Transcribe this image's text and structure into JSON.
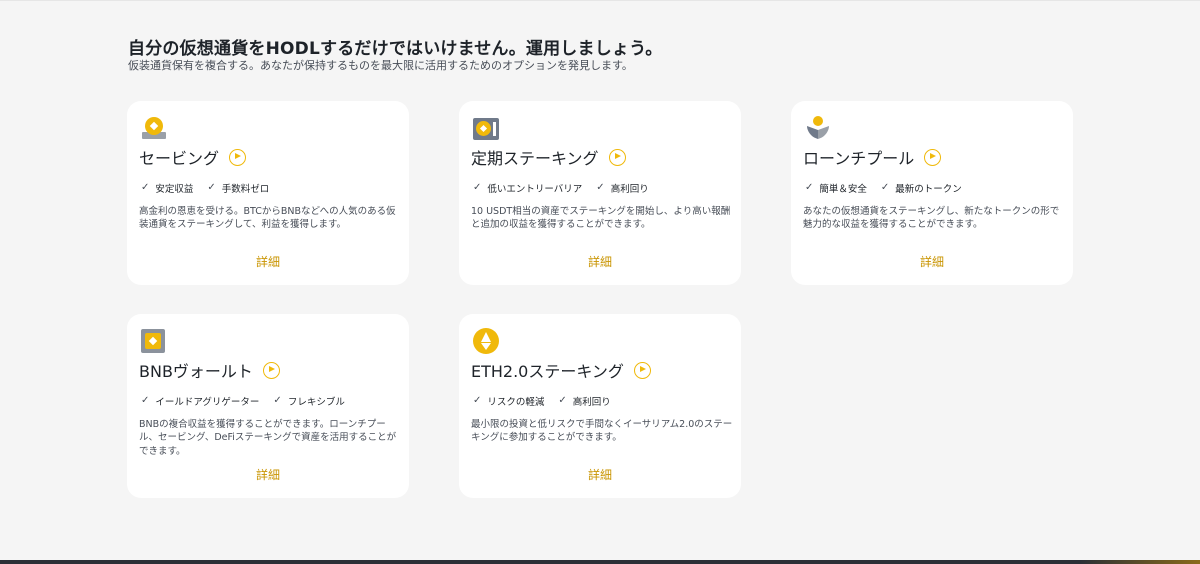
{
  "header": {
    "title": "自分の仮想通貨をHODLするだけではいけません。運用しましょう。",
    "subtitle": "仮装通貨保有を複合する。あなたが保持するものを最大限に活用するためのオプションを発見します。"
  },
  "colors": {
    "accent": "#f0b90b",
    "link": "#c99400",
    "card_bg": "#ffffff",
    "page_bg": "#f5f5f5"
  },
  "cards": [
    {
      "icon": "savings-coin-icon",
      "title": "セービング",
      "features": [
        "安定収益",
        "手数料ゼロ"
      ],
      "description": "高金利の恩恵を受ける。BTCからBNBなどへの人気のある仮装通貨をステーキングして、利益を獲得します。",
      "more_label": "詳細"
    },
    {
      "icon": "locked-staking-icon",
      "title": "定期ステーキング",
      "features": [
        "低いエントリーバリア",
        "高利回り"
      ],
      "description": "10 USDT相当の資産でステーキングを開始し、より高い報酬と追加の収益を獲得することができます。",
      "more_label": "詳細"
    },
    {
      "icon": "liquidity-pool-icon",
      "title": "ローンチプール",
      "features": [
        "簡単＆安全",
        "最新のトークン"
      ],
      "description": "あなたの仮想通貨をステーキングし、新たなトークンの形で魅力的な収益を獲得することができます。",
      "more_label": "詳細"
    },
    {
      "icon": "bnb-vault-icon",
      "title": "BNBヴォールト",
      "features": [
        "イールドアグリゲーター",
        "フレキシブル"
      ],
      "description": "BNBの複合収益を獲得することができます。ローンチプール、セービング、DeFiステーキングで資産を活用することができます。",
      "more_label": "詳細"
    },
    {
      "icon": "eth-coin-icon",
      "title": "ETH2.0ステーキング",
      "features": [
        "リスクの軽減",
        "高利回り"
      ],
      "description": "最小限の投資と低リスクで手間なくイーサリアム2.0のステーキングに参加することができます。",
      "more_label": "詳細"
    }
  ]
}
